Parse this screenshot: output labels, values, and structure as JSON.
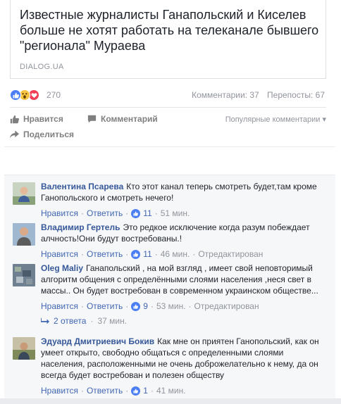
{
  "link": {
    "title": "Известные журналисты Ганапольский и Киселев больше не хотят работать на телеканале бывшего \"регионала\" Мураева",
    "domain": "DIALOG.UA"
  },
  "reactions": {
    "count": "270",
    "comments": "Комментарии: 37",
    "shares": "Перепосты: 67",
    "icons": [
      "like-icon",
      "wow-icon",
      "love-icon"
    ]
  },
  "actions": {
    "like": "Нравится",
    "comment": "Комментарий",
    "share": "Поделиться",
    "sort": "Популярные комментарии"
  },
  "comments": [
    {
      "author": "Валентина Псарева",
      "text": "Кто этот канал теперь смотреть будет,там кроме Ганопольского и смотреть нечего!",
      "like": "Нравится",
      "reply": "Ответить",
      "likes": "11",
      "time": "51 мин.",
      "edited": ""
    },
    {
      "author": "Владимир Гертель",
      "text": "Это редкое исключение когда разум побеждает алчность!Они будут востребованы.!",
      "like": "Нравится",
      "reply": "Ответить",
      "likes": "11",
      "time": "46 мин.",
      "edited": "Отредактирован"
    },
    {
      "author": "Oleg Maliy",
      "text": "Ганапольский , на мой взгляд , имеет свой неповторимый алгоритм общения с определёнными слоями населения ,неся свет в массы.. Он будет востребован в современном украинском обществе...",
      "like": "Нравится",
      "reply": "Ответить",
      "likes": "9",
      "time": "53 мин.",
      "edited": "Отредактирован",
      "replies": "2 ответа",
      "replies_time": "37 мин."
    },
    {
      "author": "Эдуард Дмитриевич Бокив",
      "text": "Как мне он приятен Ганопольский, как он умеет открыто, свободно общаться с определенными слоями населения, расположенными не очень доброжелательно к нему, да он всегда будет востребован и полезен обществу",
      "like": "Нравится",
      "reply": "Ответить",
      "likes": "1",
      "time": "41 мин.",
      "edited": ""
    }
  ],
  "colors": {
    "link": "#365899",
    "action_link": "#4267b2",
    "muted": "#90949c",
    "like_blue": "#4c7ff4"
  }
}
